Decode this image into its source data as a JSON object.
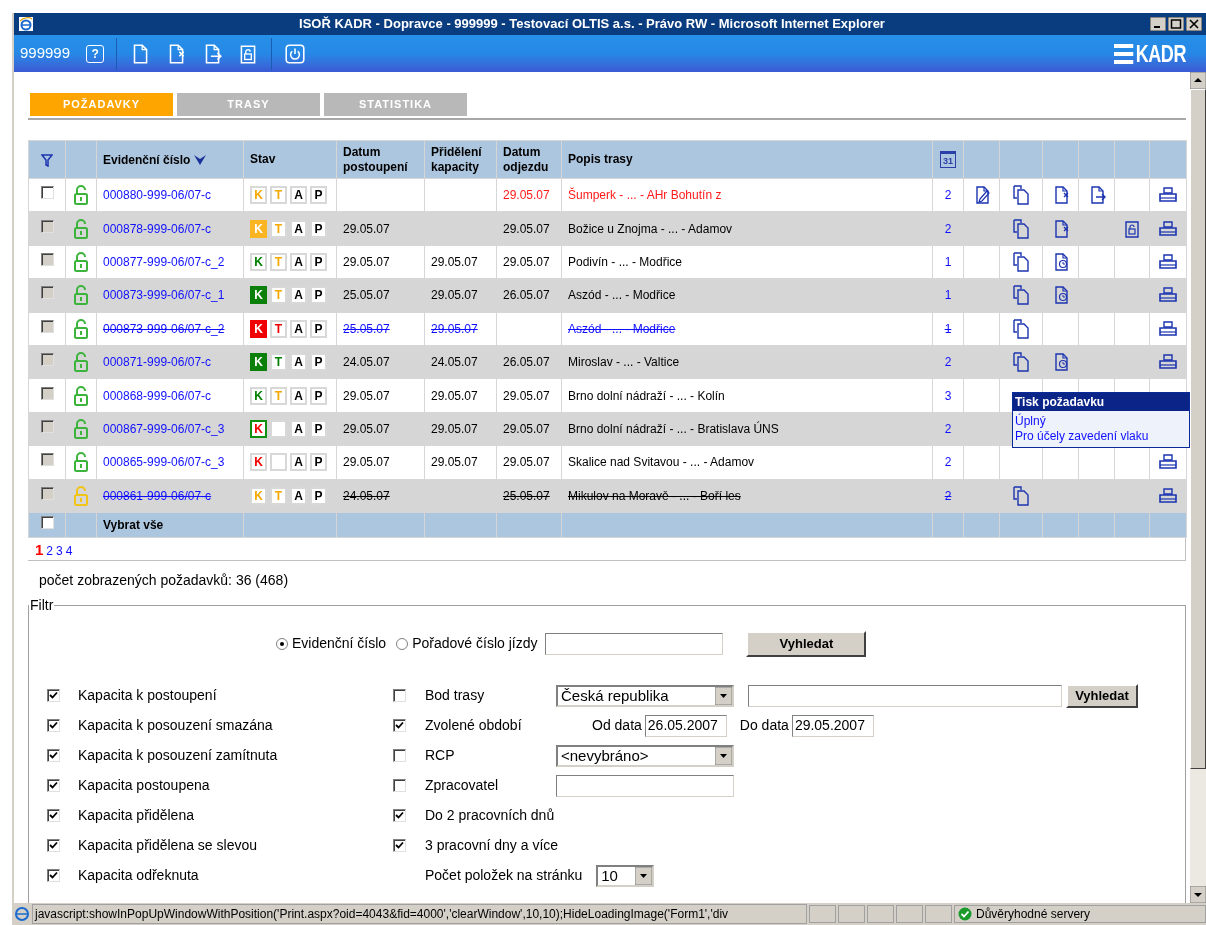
{
  "window": {
    "title": "ISOŘ KADR - Dopravce - 999999 - Testovací OLTIS a.s. - Právo RW - Microsoft Internet Explorer"
  },
  "toolbar": {
    "user": "999999",
    "help_label": "?",
    "logo": "KADR"
  },
  "tabs": [
    {
      "label": "POŽADAVKY",
      "selected": true
    },
    {
      "label": "TRASY",
      "selected": false
    },
    {
      "label": "STATISTIKA",
      "selected": false
    }
  ],
  "table": {
    "columns": [
      "Evidenční číslo",
      "Stav",
      "Datum postoupení",
      "Přidělení kapacity",
      "Datum odjezdu",
      "Popis trasy"
    ],
    "calendar_label": "31",
    "rows": [
      {
        "checked": false,
        "disabled": false,
        "lock": {
          "color": "#3cb43c"
        },
        "number": "000880-999-06/07-c",
        "alert": true,
        "struck": false,
        "linked": false,
        "stav": [
          {
            "kind": "letter",
            "letter": "K",
            "color": "#f5a800",
            "filled": false,
            "framed": false
          },
          {
            "kind": "letter",
            "letter": "T",
            "color": "#f5a800",
            "filled": false,
            "framed": false
          },
          {
            "kind": "letter",
            "letter": "A",
            "color": "#000000",
            "filled": false,
            "framed": false
          },
          {
            "kind": "letter",
            "letter": "P",
            "color": "#000000",
            "filled": false,
            "framed": false
          }
        ],
        "odjezd": "29.05.07",
        "route": "Šumperk - ... - AHr Bohutín z",
        "count": "2",
        "actions": [
          {
            "kind": "edit"
          },
          {
            "kind": "copy"
          },
          {
            "kind": "cancel"
          },
          {
            "kind": "forward"
          },
          {
            "kind": "blank"
          },
          {
            "kind": "print"
          }
        ]
      },
      {
        "checked": false,
        "disabled": true,
        "lock": {
          "color": "#3cb43c"
        },
        "number": "000878-999-06/07-c",
        "alert": false,
        "struck": false,
        "linked": false,
        "stav": [
          {
            "kind": "letter",
            "letter": "K",
            "color": "#f9b522",
            "filled": true,
            "framed": false
          },
          {
            "kind": "letter",
            "letter": "T",
            "color": "#f5a800",
            "filled": false,
            "framed": false
          },
          {
            "kind": "letter",
            "letter": "A",
            "color": "#000000",
            "filled": false,
            "framed": false
          },
          {
            "kind": "letter",
            "letter": "P",
            "color": "#000000",
            "filled": false,
            "framed": false
          }
        ],
        "postoupeni": "29.05.07",
        "odjezd": "29.05.07",
        "route": "Božice u Znojma - ... - Adamov",
        "count": "2",
        "actions": [
          {
            "kind": "blank"
          },
          {
            "kind": "copy"
          },
          {
            "kind": "cancel"
          },
          {
            "kind": "blank"
          },
          {
            "kind": "unlock"
          },
          {
            "kind": "print"
          }
        ]
      },
      {
        "checked": false,
        "disabled": true,
        "lock": {
          "color": "#3cb43c"
        },
        "number": "000877-999-06/07-c_2",
        "alert": false,
        "struck": false,
        "linked": false,
        "stav": [
          {
            "kind": "letter",
            "letter": "K",
            "color": "#008000",
            "filled": false,
            "framed": false
          },
          {
            "kind": "letter",
            "letter": "T",
            "color": "#f5a800",
            "filled": false,
            "framed": false
          },
          {
            "kind": "letter",
            "letter": "A",
            "color": "#000000",
            "filled": false,
            "framed": false
          },
          {
            "kind": "letter",
            "letter": "P",
            "color": "#000000",
            "filled": false,
            "framed": false
          }
        ],
        "postoupeni": "29.05.07",
        "prideleni": "29.05.07",
        "odjezd": "29.05.07",
        "route": "Podivín - ... - Modřice",
        "count": "1",
        "actions": [
          {
            "kind": "blank"
          },
          {
            "kind": "copy"
          },
          {
            "kind": "pending"
          },
          {
            "kind": "blank"
          },
          {
            "kind": "blank"
          },
          {
            "kind": "print"
          }
        ]
      },
      {
        "checked": false,
        "disabled": true,
        "lock": {
          "color": "#3cb43c"
        },
        "number": "000873-999-06/07-c_1",
        "alert": false,
        "struck": false,
        "linked": false,
        "stav": [
          {
            "kind": "letter",
            "letter": "K",
            "color": "#0a800a",
            "filled": true,
            "framed": false
          },
          {
            "kind": "letter",
            "letter": "T",
            "color": "#f5a800",
            "filled": false,
            "framed": false
          },
          {
            "kind": "letter",
            "letter": "A",
            "color": "#000000",
            "filled": false,
            "framed": false
          },
          {
            "kind": "letter",
            "letter": "P",
            "color": "#000000",
            "filled": false,
            "framed": false
          }
        ],
        "postoupeni": "25.05.07",
        "prideleni": "29.05.07",
        "odjezd": "26.05.07",
        "route": "Aszód - ... - Modřice",
        "count": "1",
        "actions": [
          {
            "kind": "blank"
          },
          {
            "kind": "copy"
          },
          {
            "kind": "pending"
          },
          {
            "kind": "blank"
          },
          {
            "kind": "blank"
          },
          {
            "kind": "print"
          }
        ]
      },
      {
        "checked": false,
        "disabled": true,
        "lock": {
          "color": "#3cb43c"
        },
        "number": "000873-999-06/07-c_2",
        "alert": false,
        "struck": true,
        "linked": true,
        "stav": [
          {
            "kind": "letter",
            "letter": "K",
            "color": "#f00000",
            "filled": true,
            "framed": false
          },
          {
            "kind": "letter",
            "letter": "T",
            "color": "#f00000",
            "filled": false,
            "framed": false
          },
          {
            "kind": "letter",
            "letter": "A",
            "color": "#000000",
            "filled": false,
            "framed": false
          },
          {
            "kind": "letter",
            "letter": "P",
            "color": "#000000",
            "filled": false,
            "framed": false
          }
        ],
        "postoupeni": "25.05.07",
        "prideleni": "29.05.07",
        "route": "Aszód - ... - Modřice",
        "count": "1",
        "actions": [
          {
            "kind": "blank"
          },
          {
            "kind": "copy"
          },
          {
            "kind": "blank"
          },
          {
            "kind": "blank"
          },
          {
            "kind": "blank"
          },
          {
            "kind": "print"
          }
        ]
      },
      {
        "checked": false,
        "disabled": true,
        "lock": {
          "color": "#3cb43c"
        },
        "number": "000871-999-06/07-c",
        "alert": false,
        "struck": false,
        "linked": false,
        "stav": [
          {
            "kind": "letter",
            "letter": "K",
            "color": "#0a800a",
            "filled": true,
            "framed": false
          },
          {
            "kind": "letter",
            "letter": "T",
            "color": "#008000",
            "filled": false,
            "framed": false
          },
          {
            "kind": "letter",
            "letter": "A",
            "color": "#000000",
            "filled": false,
            "framed": false
          },
          {
            "kind": "letter",
            "letter": "P",
            "color": "#000000",
            "filled": false,
            "framed": false
          }
        ],
        "postoupeni": "24.05.07",
        "prideleni": "24.05.07",
        "odjezd": "26.05.07",
        "route": "Miroslav - ... - Valtice",
        "count": "2",
        "actions": [
          {
            "kind": "blank"
          },
          {
            "kind": "copy"
          },
          {
            "kind": "pending"
          },
          {
            "kind": "blank"
          },
          {
            "kind": "blank"
          },
          {
            "kind": "print"
          }
        ]
      },
      {
        "checked": false,
        "disabled": true,
        "lock": {
          "color": "#3cb43c"
        },
        "number": "000868-999-06/07-c",
        "alert": false,
        "struck": false,
        "linked": false,
        "stav": [
          {
            "kind": "letter",
            "letter": "K",
            "color": "#008000",
            "filled": false,
            "framed": false
          },
          {
            "kind": "letter",
            "letter": "T",
            "color": "#f5a800",
            "filled": false,
            "framed": false
          },
          {
            "kind": "letter",
            "letter": "A",
            "color": "#000000",
            "filled": false,
            "framed": false
          },
          {
            "kind": "letter",
            "letter": "P",
            "color": "#000000",
            "filled": false,
            "framed": false
          }
        ],
        "postoupeni": "29.05.07",
        "prideleni": "29.05.07",
        "odjezd": "29.05.07",
        "route": "Brno dolní nádraží - ... - Kolín",
        "count": "3",
        "actions": [
          {
            "kind": "blank"
          },
          {
            "kind": "blank"
          },
          {
            "kind": "blank"
          },
          {
            "kind": "blank"
          },
          {
            "kind": "blank"
          },
          {
            "kind": "blank"
          }
        ]
      },
      {
        "checked": false,
        "disabled": true,
        "lock": {
          "color": "#3cb43c"
        },
        "number": "000867-999-06/07-c_3",
        "alert": false,
        "struck": false,
        "linked": false,
        "stav": [
          {
            "kind": "letter",
            "letter": "K",
            "color": "#f00000",
            "filled": false,
            "framed": true
          },
          {
            "kind": "blank"
          },
          {
            "kind": "letter",
            "letter": "A",
            "color": "#000000",
            "filled": false,
            "framed": false
          },
          {
            "kind": "letter",
            "letter": "P",
            "color": "#000000",
            "filled": false,
            "framed": false
          }
        ],
        "postoupeni": "29.05.07",
        "prideleni": "29.05.07",
        "odjezd": "29.05.07",
        "route": "Brno dolní nádraží - ... - Bratislava ÚNS",
        "count": "2",
        "actions": [
          {
            "kind": "blank"
          },
          {
            "kind": "blank"
          },
          {
            "kind": "blank"
          },
          {
            "kind": "blank"
          },
          {
            "kind": "blank"
          },
          {
            "kind": "blank"
          }
        ]
      },
      {
        "checked": false,
        "disabled": true,
        "lock": {
          "color": "#3cb43c"
        },
        "number": "000865-999-06/07-c_3",
        "alert": false,
        "struck": false,
        "linked": false,
        "stav": [
          {
            "kind": "letter",
            "letter": "K",
            "color": "#f00000",
            "filled": false,
            "framed": false
          },
          {
            "kind": "blank"
          },
          {
            "kind": "letter",
            "letter": "A",
            "color": "#000000",
            "filled": false,
            "framed": false
          },
          {
            "kind": "letter",
            "letter": "P",
            "color": "#000000",
            "filled": false,
            "framed": false
          }
        ],
        "postoupeni": "29.05.07",
        "prideleni": "29.05.07",
        "odjezd": "29.05.07",
        "route": "Skalice nad Svitavou - ... - Adamov",
        "count": "2",
        "actions": [
          {
            "kind": "blank"
          },
          {
            "kind": "blank"
          },
          {
            "kind": "blank"
          },
          {
            "kind": "blank"
          },
          {
            "kind": "blank"
          },
          {
            "kind": "print"
          }
        ]
      },
      {
        "checked": false,
        "disabled": true,
        "lock": {
          "color": "#f2c418"
        },
        "number": "000861-999-06/07-c",
        "alert": false,
        "struck": true,
        "linked": false,
        "stav": [
          {
            "kind": "letter",
            "letter": "K",
            "color": "#f5a800",
            "filled": false,
            "framed": false
          },
          {
            "kind": "letter",
            "letter": "T",
            "color": "#f5a800",
            "filled": false,
            "framed": false
          },
          {
            "kind": "letter",
            "letter": "A",
            "color": "#000000",
            "filled": false,
            "framed": false
          },
          {
            "kind": "letter",
            "letter": "P",
            "color": "#000000",
            "filled": false,
            "framed": false
          }
        ],
        "postoupeni": "24.05.07",
        "odjezd": "25.05.07",
        "route": "Mikulov na Moravě - ... - Boří les",
        "count": "2",
        "actions": [
          {
            "kind": "blank"
          },
          {
            "kind": "copy"
          },
          {
            "kind": "blank"
          },
          {
            "kind": "blank"
          },
          {
            "kind": "blank"
          },
          {
            "kind": "print"
          }
        ]
      }
    ],
    "footer": {
      "checked": false,
      "label": "Vybrat vše"
    }
  },
  "pagination": [
    {
      "label": "1",
      "selected": true
    },
    {
      "label": "2",
      "selected": false
    },
    {
      "label": "3",
      "selected": false
    },
    {
      "label": "4",
      "selected": false
    }
  ],
  "popup": {
    "title": "Tisk požadavku",
    "items": [
      "Úplný",
      "Pro účely zavedení vlaku"
    ]
  },
  "count": "počet zobrazených požadavků: 36 (468)",
  "filter": {
    "legend": "Filtr",
    "search_by": [
      {
        "label": "Evidenční číslo",
        "selected": true
      },
      {
        "label": "Pořadové číslo jízdy",
        "selected": false
      }
    ],
    "search_button": "Vyhledat",
    "left": [
      {
        "label": "Kapacita k postoupení",
        "checked": true
      },
      {
        "label": "Kapacita k posouzení smazána",
        "checked": true
      },
      {
        "label": "Kapacita k posouzení zamítnuta",
        "checked": true
      },
      {
        "label": "Kapacita postoupena",
        "checked": true
      },
      {
        "label": "Kapacita přidělena",
        "checked": true
      },
      {
        "label": "Kapacita přidělena se slevou",
        "checked": true
      },
      {
        "label": "Kapacita odřeknuta",
        "checked": true
      }
    ],
    "right": [
      {
        "kind": "search",
        "label": "Bod trasy",
        "checked": false,
        "select": "Česká republika",
        "button": "Vyhledat"
      },
      {
        "kind": "dates",
        "label": "Zvolené období",
        "checked": true,
        "from_label": "Od data",
        "from": "26.05.2007",
        "to_label": "Do data",
        "to": "29.05.2007"
      },
      {
        "kind": "select",
        "label": "RCP",
        "checked": false,
        "select": "<nevybráno>"
      },
      {
        "kind": "input",
        "label": "Zpracovatel",
        "checked": false
      },
      {
        "kind": "plain",
        "label": "Do 2 pracovních dnů",
        "checked": true
      },
      {
        "kind": "plain",
        "label": "3 pracovní dny a více",
        "checked": true
      },
      {
        "kind": "pagesize",
        "label": "Počet položek na stránku",
        "select": "10"
      }
    ]
  },
  "status_bar": {
    "text": "javascript:showInPopUpWindowWithPosition('Print.aspx?oid=4043&fid=4000','clearWindow',10,10);HideLoadingImage('Form1','div",
    "zone": "Důvěryhodné servery"
  }
}
